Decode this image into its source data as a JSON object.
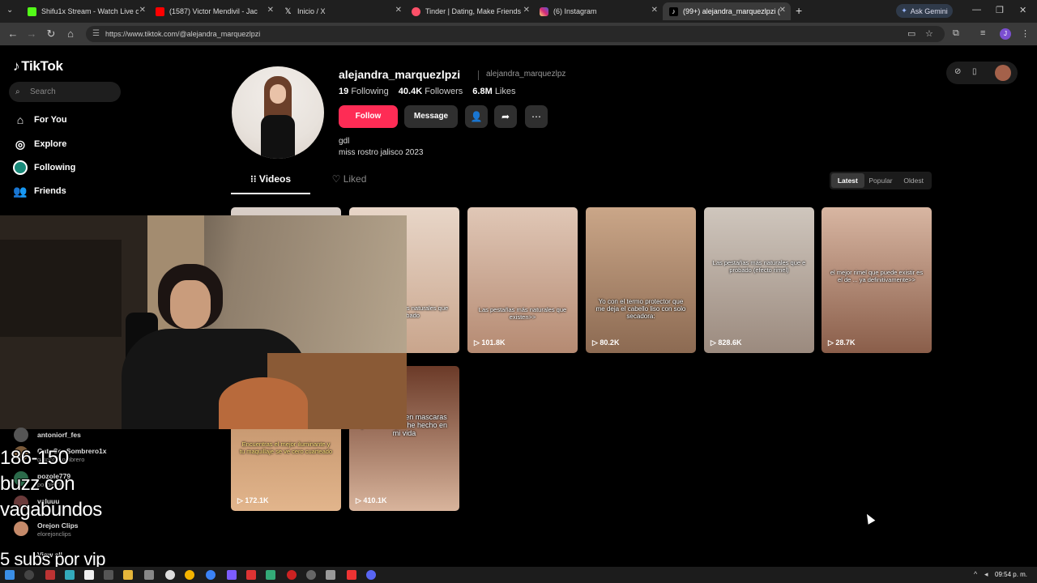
{
  "browser": {
    "tabs": [
      {
        "title": "Shifu1x Stream - Watch Live on",
        "color": "#53fc18",
        "icon": "kick-icon"
      },
      {
        "title": "(1587) Victor Mendivil - Jac",
        "color": "#ff0000",
        "icon": "youtube-icon"
      },
      {
        "title": "Inicio / X",
        "color": "#ffffff",
        "icon": "x-icon"
      },
      {
        "title": "Tinder | Dating, Make Friends &",
        "color": "#fd5068",
        "icon": "tinder-icon"
      },
      {
        "title": "(6) Instagram",
        "color": "#d62976",
        "icon": "instagram-icon"
      },
      {
        "title": "(99+) alejandra_marquezlpzi (@",
        "color": "#ffffff",
        "icon": "tiktok-icon"
      }
    ],
    "new_tab": "+",
    "ask_gemini": "Ask Gemini",
    "url": "https://www.tiktok.com/@alejandra_marquezlpzi",
    "profile_initial": "J"
  },
  "tiktok": {
    "logo": "TikTok",
    "search_placeholder": "Search",
    "nav": [
      "For You",
      "Explore",
      "Following",
      "Friends"
    ],
    "profile": {
      "username": "alejandra_marquezlpzi",
      "handle": "alejandra_marquezlpz",
      "following_count": "19",
      "following_label": "Following",
      "followers_count": "40.4K",
      "followers_label": "Followers",
      "likes_count": "6.8M",
      "likes_label": "Likes",
      "follow_btn": "Follow",
      "message_btn": "Message",
      "bio_line1": "gdl",
      "bio_line2": "miss rostro jalisco 2023"
    },
    "tabs": {
      "videos": "Videos",
      "liked": "Liked"
    },
    "sort": [
      "Latest",
      "Popular",
      "Oldest"
    ],
    "videos": [
      {
        "views": "101.8K",
        "caption": "Las pestañas más naturales que existen>>"
      },
      {
        "views": "80.2K",
        "caption": "Yo con el termo protector que me deja el cabello liso con solo secadora:"
      },
      {
        "views": "828.6K",
        "caption": "Las pestañas más naturales que e probado (efecto rimel)"
      },
      {
        "views": "28.7K",
        "caption": "el mejor rimel que puede existir es el de ... ya definitivamente>>"
      },
      {
        "views": "172.1K",
        "caption": "Encuentras el mejor iluminante y tu maquillaje se ve cero cuarteado"
      },
      {
        "views": "410.1K",
        "caption": "mejor opción en mascaras pestañas que he hecho en mi vida"
      }
    ],
    "partial_captions": [
      "el mejor rimel que puede existir es el de",
      "Las pestañas más naturales que he probado"
    ]
  },
  "stream_overlay": {
    "chat": [
      {
        "name": "antoniorf_fes",
        "sub": ""
      },
      {
        "name": "GatoConSombrero1x",
        "sub": "gatoconsombrero"
      },
      {
        "name": "pozole779",
        "sub": "pozole779"
      },
      {
        "name": "valuuu",
        "sub": ""
      },
      {
        "name": "Orejon Clips",
        "sub": "elorejonclips"
      }
    ],
    "view_all": "View all",
    "line1": "186-150",
    "line2": "buzz con",
    "line3": "vagabundos",
    "line4": "5 subs por vip"
  },
  "taskbar": {
    "time": "09:54 p. m."
  }
}
